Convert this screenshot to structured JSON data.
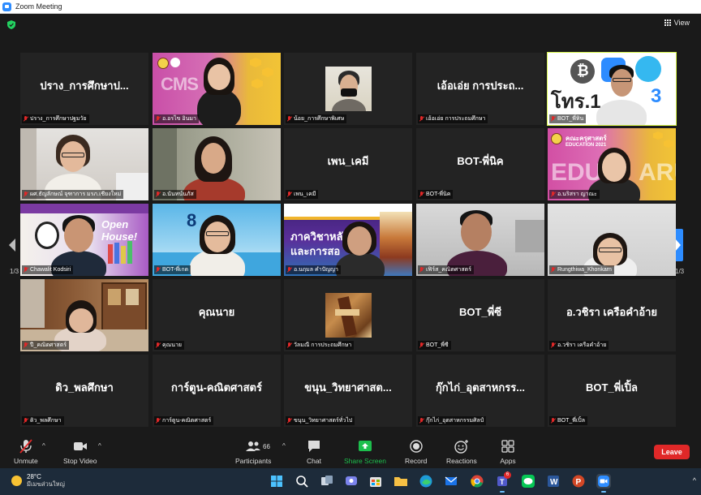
{
  "window": {
    "title": "Zoom Meeting"
  },
  "view_button": {
    "label": "View"
  },
  "pagination": {
    "left": "1/3",
    "right": "1/3"
  },
  "tiles": [
    {
      "big": "ปราง_การศึกษาป...",
      "label": "ปราง_การศึกษาปฐมวัย",
      "video": false
    },
    {
      "big": "",
      "label": "อ.อรไข อินมา",
      "video": true
    },
    {
      "big": "",
      "label": "น้อย_การศึกษาพิเศษ",
      "video": true
    },
    {
      "big": "เอ้อเอ่ย การประถ...",
      "label": "เอ้อเอ่ย การประถมศึกษา",
      "video": false
    },
    {
      "big": "",
      "label": "BOT_พี่หิน",
      "video": true,
      "active": true
    },
    {
      "big": "",
      "label": "ผศ.ธัญลักษณ์ จุฑาการ มรภ.เชียงใหม่",
      "video": true
    },
    {
      "big": "",
      "label": "อ.นันทน์นภัส",
      "video": true
    },
    {
      "big": "เพน_เคมี",
      "label": "เพน_เคมี",
      "video": false
    },
    {
      "big": "BOT-พี่นิค",
      "label": "BOT-พี่นิค",
      "video": false
    },
    {
      "big": "",
      "label": "อ.นริสรา ญาณะ",
      "video": true
    },
    {
      "big": "",
      "label": "Chawalit Kodsiri",
      "video": true
    },
    {
      "big": "",
      "label": "BOT-พี่เกด",
      "video": true
    },
    {
      "big": "",
      "label": "อ.นฤมล คำปัญญา",
      "video": true
    },
    {
      "big": "",
      "label": "เฟิร์ส_คณิตศาสตร์",
      "video": true
    },
    {
      "big": "",
      "label": "Rungthiwa_Khonkarn",
      "video": true
    },
    {
      "big": "",
      "label": "ปี_คณิตศาสตร์",
      "video": true
    },
    {
      "big": "คุณนาย",
      "label": "คุณนาย",
      "video": false
    },
    {
      "big": "",
      "label": "วัลมณี การประถมศึกษา",
      "video": true
    },
    {
      "big": "BOT_พี่ซี",
      "label": "BOT_พี่ซี",
      "video": false
    },
    {
      "big": "อ.วชิรา เครือคำอ้าย",
      "label": "อ.วชิรา เครือคำอ้าย",
      "video": false
    },
    {
      "big": "ดิว_พลศึกษา",
      "label": "ดิว_พลศึกษา",
      "video": false
    },
    {
      "big": "การ์ตูน-คณิตศาสตร์",
      "label": "การ์ตูน-คณิตศาสตร์",
      "video": false
    },
    {
      "big": "ขนุน_วิทยาศาสต...",
      "label": "ขนุน_วิทยาศาสตร์ทั่วไป",
      "video": false
    },
    {
      "big": "กุ๊กไก่_อุตสาหกรร...",
      "label": "กุ๊กไก่_อุตสาหกรรมศิลป์",
      "video": false
    },
    {
      "big": "BOT_พี่เปิ้ล",
      "label": "BOT_พี่เปิ้ล",
      "video": false
    }
  ],
  "tile_text": {
    "banner_cms": "CMS",
    "banner_lines": "โทร.1",
    "banner_lines_num": "3",
    "edu_title": "คณะครุศาสตร์",
    "edu_sub": "EDUCATION 2021",
    "edu_big": "EDU",
    "edu_big2": "ARU",
    "house_text": "Open House!",
    "eight": "8",
    "purple_text": "ภาควิชาหลั",
    "purple_text2": "และการสอ"
  },
  "toolbar": {
    "unmute": "Unmute",
    "stop_video": "Stop Video",
    "participants": "Participants",
    "participants_count": "66",
    "chat": "Chat",
    "share_screen": "Share Screen",
    "record": "Record",
    "reactions": "Reactions",
    "apps": "Apps",
    "leave": "Leave"
  },
  "taskbar": {
    "temperature": "28°C",
    "condition": "มีเมฆส่วนใหญ่",
    "teams_badge": "6"
  },
  "colors": {
    "accent_blue": "#2d8cff",
    "leave_red": "#e02828",
    "share_green": "#1dbf4d",
    "active_outline": "#d7f54b"
  }
}
